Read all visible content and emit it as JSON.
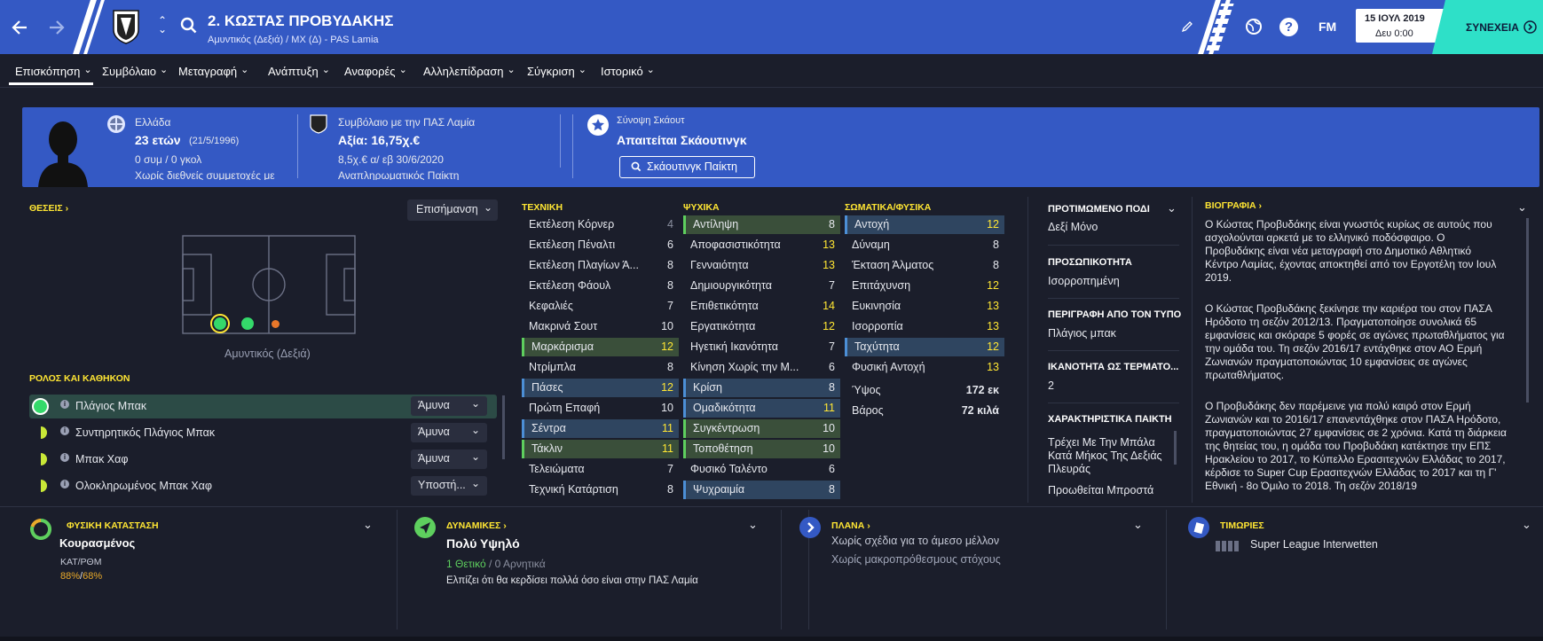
{
  "header": {
    "title": "2. ΚΩΣΤΑΣ ΠΡΟΒΥΔΑΚΗΣ",
    "subtitle": "Αμυντικός (Δεξιά) / ΜΧ (Δ) - PAS Lamia",
    "date": "15 ΙΟΥΛ 2019",
    "time": "Δευ 0:00",
    "continue_label": "ΣΥΝΕΧΕΙΑ",
    "fm_label": "FM",
    "help_icon": "?"
  },
  "menu": [
    "Επισκόπηση",
    "Συμβόλαιο",
    "Μεταγραφή",
    "Ανάπτυξη",
    "Αναφορές",
    "Αλληλεπίδραση",
    "Σύγκριση",
    "Ιστορικό"
  ],
  "info": {
    "nationality": "Ελλάδα",
    "age": "23 ετών",
    "dob": "(21/5/1996)",
    "caps": "0 συμ / 0 γκολ",
    "intl_note": "Χωρίς διεθνείς συμμετοχές με",
    "contract_label": "Συμβόλαιο με την ΠΑΣ Λαμία",
    "value": "Αξία: 16,75χ.€",
    "wage": "8,5χ.€ α/ εβ 30/6/2020",
    "contract_note": "Αναπληρωματικός Παίκτη",
    "scout_label": "Σύνοψη Σκάουτ",
    "scout_req": "Απαιτείται Σκάουτινγκ",
    "scout_button": "Σκάουτινγκ Παίκτη"
  },
  "positions": {
    "header": "ΘΕΣΕΙΣ",
    "dropdown": "Επισήμανση",
    "pitch_label": "Αμυντικός (Δεξιά)"
  },
  "roles": {
    "header": "ΡΟΛΟΣ ΚΑΙ ΚΑΘΗΚΟΝ",
    "items": [
      {
        "name": "Πλάγιος Μπακ",
        "duty": "Άμυνα"
      },
      {
        "name": "Συντηρητικός Πλάγιος Μπακ",
        "duty": "Άμυνα"
      },
      {
        "name": "Μπακ Χαφ",
        "duty": "Άμυνα"
      },
      {
        "name": "Ολοκληρωμένος Μπακ Χαφ",
        "duty": "Υποστή..."
      }
    ]
  },
  "attributes": {
    "technical_header": "ΤΕΧΝΙΚΗ",
    "mental_header": "ΨΥΧΙΚΑ",
    "physical_header": "ΣΩΜΑΤΙΚΑ/ΦΥΣΙΚΑ",
    "technical": [
      {
        "n": "Εκτέλεση Κόρνερ",
        "v": "4"
      },
      {
        "n": "Εκτέλεση Πέναλτι",
        "v": "6"
      },
      {
        "n": "Εκτέλεση Πλαγίων Ά...",
        "v": "8"
      },
      {
        "n": "Εκτέλεση Φάουλ",
        "v": "8"
      },
      {
        "n": "Κεφαλιές",
        "v": "7"
      },
      {
        "n": "Μακρινά Σουτ",
        "v": "10"
      },
      {
        "n": "Μαρκάρισμα",
        "v": "12"
      },
      {
        "n": "Ντρίμπλα",
        "v": "8"
      },
      {
        "n": "Πάσες",
        "v": "12"
      },
      {
        "n": "Πρώτη Επαφή",
        "v": "10"
      },
      {
        "n": "Σέντρα",
        "v": "11"
      },
      {
        "n": "Τάκλιν",
        "v": "11"
      },
      {
        "n": "Τελειώματα",
        "v": "7"
      },
      {
        "n": "Τεχνική Κατάρτιση",
        "v": "8"
      }
    ],
    "mental": [
      {
        "n": "Αντίληψη",
        "v": "8"
      },
      {
        "n": "Αποφασιστικότητα",
        "v": "13"
      },
      {
        "n": "Γενναιότητα",
        "v": "13"
      },
      {
        "n": "Δημιουργικότητα",
        "v": "7"
      },
      {
        "n": "Επιθετικότητα",
        "v": "14"
      },
      {
        "n": "Εργατικότητα",
        "v": "12"
      },
      {
        "n": "Ηγετική Ικανότητα",
        "v": "7"
      },
      {
        "n": "Κίνηση Χωρίς την Μ...",
        "v": "6"
      },
      {
        "n": "Κρίση",
        "v": "8"
      },
      {
        "n": "Ομαδικότητα",
        "v": "11"
      },
      {
        "n": "Συγκέντρωση",
        "v": "10"
      },
      {
        "n": "Τοποθέτηση",
        "v": "10"
      },
      {
        "n": "Φυσικό Ταλέντο",
        "v": "6"
      },
      {
        "n": "Ψυχραιμία",
        "v": "8"
      }
    ],
    "physical": [
      {
        "n": "Αντοχή",
        "v": "12"
      },
      {
        "n": "Δύναμη",
        "v": "8"
      },
      {
        "n": "Έκταση Άλματος",
        "v": "8"
      },
      {
        "n": "Επιτάχυνση",
        "v": "12"
      },
      {
        "n": "Ευκινησία",
        "v": "13"
      },
      {
        "n": "Ισορροπία",
        "v": "13"
      },
      {
        "n": "Ταχύτητα",
        "v": "12"
      },
      {
        "n": "Φυσική Αντοχή",
        "v": "13"
      }
    ],
    "height_label": "Ύψος",
    "height": "172 εκ",
    "weight_label": "Βάρος",
    "weight": "72 κιλά"
  },
  "details": {
    "foot_header": "ΠΡΟΤΙΜΩΜΕΝΟ ΠΟΔΙ",
    "foot": "Δεξί Μόνο",
    "personality_header": "ΠΡΟΣΩΠΙΚΟΤΗΤΑ",
    "personality": "Ισορροπημένη",
    "type_header": "ΠΕΡΙΓΡΑΦΗ ΑΠΟ ΤΟΝ ΤΥΠΟ",
    "type": "Πλάγιος μπακ",
    "goalkeeper_header": "ΙΚΑΝΟΤΗΤΑ ΩΣ ΤΕΡΜΑΤΟ...",
    "goalkeeper": "2",
    "traits_header": "ΧΑΡΑΚΤΗΡΙΣΤΙΚΑ ΠΑΙΚΤΗ",
    "trait1": "Τρέχει Με Την Μπάλα Κατά Μήκος Της Δεξιάς Πλευράς",
    "trait2": "Προωθείται Μπροστά"
  },
  "bio": {
    "header": "ΒΙΟΓΡΑΦΙΑ",
    "p1": "Ο Κώστας Προβυδάκης είναι γνωστός κυρίως σε αυτούς που ασχολούνται αρκετά με το ελληνικό ποδόσφαιρο. Ο Προβυδάκης είναι νέα μεταγραφή στο Δημοτικό Αθλητικό Κέντρο Λαμίας, έχοντας αποκτηθεί από τον Εργοτέλη τον Ιουλ 2019.",
    "p2": "Ο Κώστας Προβυδάκης ξεκίνησε την καριέρα του στον ΠΑΣΑ Ηρόδοτο τη σεζόν 2012/13. Πραγματοποίησε συνολικά 65 εμφανίσεις και σκόραρε 5 φορές σε αγώνες πρωταθλήματος για την ομάδα του. Τη σεζόν 2016/17 εντάχθηκε στον ΑΟ Ερμή Ζωνιανών πραγματοποιώντας 10 εμφανίσεις σε αγώνες πρωταθλήματος.",
    "p3": "Ο Προβυδάκης δεν παρέμεινε για πολύ καιρό στον Ερμή Ζωνιανών και το 2016/17 επανεντάχθηκε στον ΠΑΣΑ Ηρόδοτο, πραγματοποιώντας 27 εμφανίσεις σε 2 χρόνια. Κατά τη διάρκεια της θητείας του, η ομάδα του Προβυδάκη κατέκτησε την ΕΠΣ Ηρακλείου το 2017, το Κύπελλο Ερασιτεχνών Ελλάδας το 2017, κέρδισε το Super Cup Ερασιτεχνών Ελλάδας το 2017 και τη Γ' Εθνική - 8ο Όμιλο το 2018. Τη σεζόν 2018/19"
  },
  "bottom": {
    "condition_header": "ΦΥΣΙΚΗ ΚΑΤΑΣΤΑΣΗ",
    "condition": "Κουρασμένος",
    "cond_label": "ΚΑΤ/ΡΘΜ",
    "cond_val1": "88%",
    "cond_val2": "68%",
    "dynamics_header": "ΔΥΝΑΜΙΚΕΣ",
    "dynamics": "Πολύ Υψηλό",
    "positive": "1 Θετικό",
    "negative": "0 Αρνητικά",
    "dyn_note": "Ελπίζει ότι θα κερδίσει πολλά όσο είναι στην ΠΑΣ Λαμία",
    "plans_header": "ΠΛΑΝΑ",
    "plan1": "Χωρίς σχέδια για το άμεσο μέλλον",
    "plan2": "Χωρίς μακροπρόθεσμους στόχους",
    "penalties_header": "ΤΙΜΩΡΙΕΣ",
    "penalty": "Super League Interwetten"
  },
  "colors": {
    "accent": "#3459c4",
    "highlight": "#ffe633",
    "continue": "#2ee0c8",
    "good": "#5ecf5e"
  }
}
